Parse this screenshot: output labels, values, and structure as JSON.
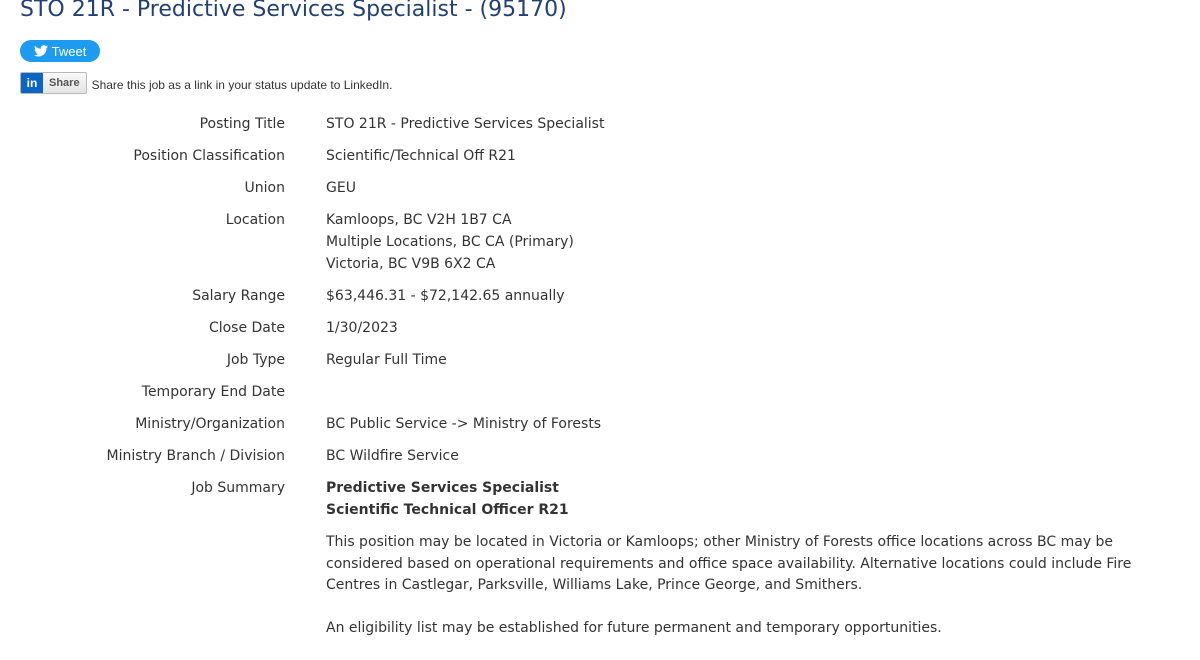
{
  "page": {
    "title": "STO 21R - Predictive Services Specialist - (95170)"
  },
  "social": {
    "tweet_label": "Tweet",
    "linkedin_logo": "in",
    "linkedin_share_label": "Share",
    "linkedin_text": "Share this job as a link in your status update to LinkedIn.",
    "twitter_color": "#1d9bf0",
    "linkedin_color": "#0a66c2"
  },
  "details": {
    "posting_title": {
      "label": "Posting Title",
      "value": "STO 21R - Predictive Services Specialist"
    },
    "position_classification": {
      "label": "Position Classification",
      "value": "Scientific/Technical Off R21"
    },
    "union": {
      "label": "Union",
      "value": "GEU"
    },
    "location": {
      "label": "Location",
      "values": [
        "Kamloops, BC V2H 1B7 CA",
        "Multiple Locations, BC CA (Primary)",
        "Victoria, BC V9B 6X2 CA"
      ]
    },
    "salary_range": {
      "label": "Salary Range",
      "value": "$63,446.31 - $72,142.65 annually"
    },
    "close_date": {
      "label": "Close Date",
      "value": "1/30/2023"
    },
    "job_type": {
      "label": "Job Type",
      "value": "Regular Full Time"
    },
    "temporary_end_date": {
      "label": "Temporary End Date",
      "value": ""
    },
    "ministry_organization": {
      "label": "Ministry/Organization",
      "value": "BC Public Service -> Ministry of Forests"
    },
    "ministry_branch": {
      "label": "Ministry Branch / Division",
      "value": "BC Wildfire Service"
    },
    "job_summary": {
      "label": "Job Summary",
      "heading1": "Predictive Services Specialist",
      "heading2": "Scientific Technical Officer R21",
      "paragraphs": [
        "This position may be located in Victoria or Kamloops; other Ministry of Forests office locations across BC may be considered based on operational requirements and office space availability. Alternative locations could include Fire Centres in Castlegar, Parksville, Williams Lake, Prince George, and Smithers.",
        "An eligibility list may be established for future permanent and temporary opportunities."
      ]
    }
  }
}
